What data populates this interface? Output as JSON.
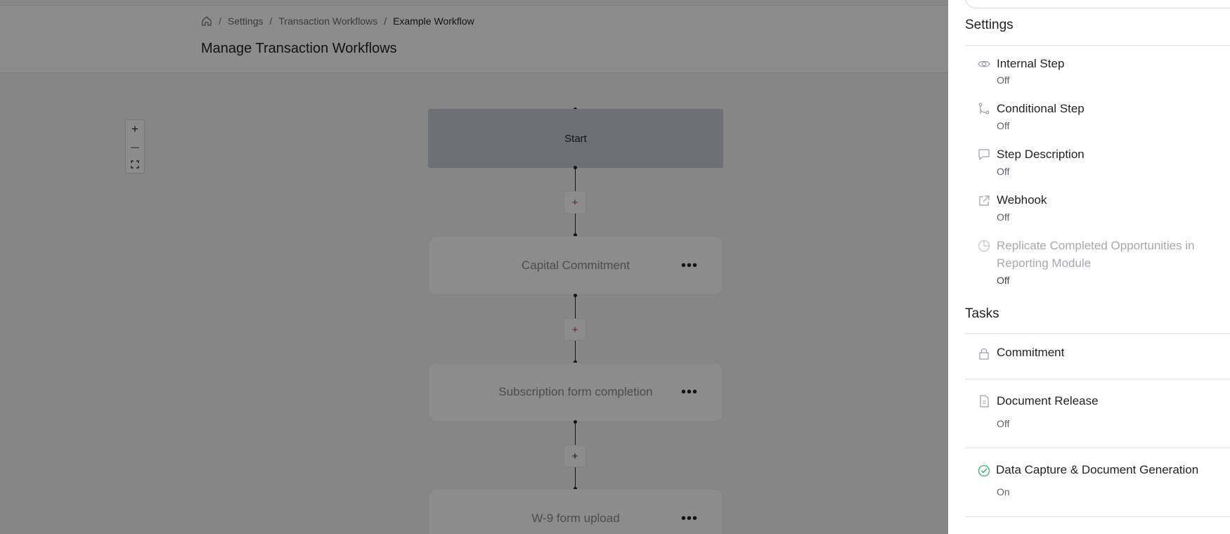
{
  "breadcrumb": {
    "settings": "Settings",
    "workflows": "Transaction Workflows",
    "current": "Example Workflow"
  },
  "page_title": "Manage Transaction Workflows",
  "zoom_controls": {
    "zoom_in": "+",
    "zoom_out": "—",
    "fit": "⛶"
  },
  "workflow": {
    "start": "Start",
    "add_label": "+",
    "more_label": "•••",
    "steps": [
      {
        "label": "Capital Commitment"
      },
      {
        "label": "Subscription form completion"
      },
      {
        "label": "W-9 form upload"
      }
    ]
  },
  "drawer": {
    "settings_title": "Settings",
    "settings": [
      {
        "label": "Internal Step",
        "status": "Off",
        "icon": "eye-icon"
      },
      {
        "label": "Conditional Step",
        "status": "Off",
        "icon": "branch-icon"
      },
      {
        "label": "Step Description",
        "status": "Off",
        "icon": "comment-icon"
      },
      {
        "label": "Webhook",
        "status": "Off",
        "icon": "external-link-icon"
      },
      {
        "label_line1": "Replicate Completed Opportunities in",
        "label_line2": "Reporting Module",
        "status": "Off",
        "icon": "pie-chart-icon",
        "disabled": true
      }
    ],
    "tasks_title": "Tasks",
    "tasks": [
      {
        "label": "Commitment",
        "icon": "lock-icon"
      },
      {
        "label": "Document Release",
        "status": "Off",
        "icon": "document-icon"
      },
      {
        "label": "Data Capture & Document Generation",
        "status": "On",
        "icon": "check-circle-icon"
      }
    ]
  },
  "colors": {
    "overlay": "#000000",
    "success": "#2fb36b",
    "start_node": "#c9cdd6",
    "add_accent": "#c23a3a"
  }
}
